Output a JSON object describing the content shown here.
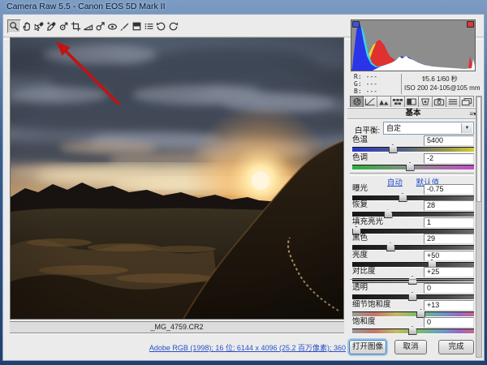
{
  "window": {
    "title": "Camera Raw 5.5 -  Canon EOS 5D Mark II"
  },
  "toolbar": {
    "tools": [
      {
        "name": "zoom-tool",
        "icon": "magnifier",
        "selected": true
      },
      {
        "name": "hand-tool",
        "icon": "hand",
        "selected": false
      },
      {
        "name": "white-balance-tool",
        "icon": "eyedropper-cursor",
        "selected": false
      },
      {
        "name": "color-sampler-tool",
        "icon": "eyedropper-plus",
        "selected": false
      },
      {
        "name": "targeted-adjustment-tool",
        "icon": "target",
        "selected": false
      },
      {
        "name": "crop-tool",
        "icon": "crop",
        "selected": false
      },
      {
        "name": "straighten-tool",
        "icon": "straighten",
        "selected": false
      },
      {
        "name": "spot-removal-tool",
        "icon": "heal",
        "selected": false
      },
      {
        "name": "red-eye-tool",
        "icon": "red-eye",
        "selected": false
      },
      {
        "name": "adjustment-brush-tool",
        "icon": "brush",
        "selected": false
      },
      {
        "name": "graduated-filter-tool",
        "icon": "grad-filter",
        "selected": false
      },
      {
        "name": "preferences-tool",
        "icon": "menu-list",
        "selected": false
      },
      {
        "name": "rotate-ccw-tool",
        "icon": "rotate-ccw",
        "selected": false
      },
      {
        "name": "rotate-cw-tool",
        "icon": "rotate-cw",
        "selected": false
      }
    ]
  },
  "annotation": {
    "type": "red-arrow",
    "points_to": "white-balance-tool",
    "color": "#c41212"
  },
  "histogram": {
    "shadow_clip_color": "#3a57d8",
    "highlight_clip_color": "#d83a3a"
  },
  "exif": {
    "r_label": "R:",
    "g_label": "G:",
    "b_label": "B:",
    "r_value": "---",
    "g_value": "---",
    "b_value": "---",
    "aperture_shutter": "f/5.6  1/60 秒",
    "iso_lens": "ISO 200  24-105@105 mm"
  },
  "tabs": [
    {
      "name": "tab-basic",
      "icon": "basic",
      "selected": true
    },
    {
      "name": "tab-tone-curve",
      "icon": "curve",
      "selected": false
    },
    {
      "name": "tab-detail",
      "icon": "detail",
      "selected": false
    },
    {
      "name": "tab-hsl-grayscale",
      "icon": "hsl",
      "selected": false
    },
    {
      "name": "tab-split-toning",
      "icon": "split",
      "selected": false
    },
    {
      "name": "tab-lens-corrections",
      "icon": "lens",
      "selected": false
    },
    {
      "name": "tab-camera-calibration",
      "icon": "camera",
      "selected": false
    },
    {
      "name": "tab-presets",
      "icon": "presets",
      "selected": false
    },
    {
      "name": "tab-snapshots",
      "icon": "snapshot",
      "selected": false
    }
  ],
  "panel": {
    "title": "基本",
    "white_balance_label": "白平衡:",
    "white_balance_value": "自定",
    "auto_link": "自动",
    "default_link": "默认值",
    "wb_sliders": [
      {
        "label": "色温",
        "value": "5400",
        "pos": 33,
        "track": "temp"
      },
      {
        "label": "色调",
        "value": "-2",
        "pos": 47,
        "track": "tint"
      }
    ],
    "tone_sliders": [
      {
        "label": "曝光",
        "value": "-0.75",
        "pos": 41,
        "track": "tone"
      },
      {
        "label": "恢复",
        "value": "28",
        "pos": 29,
        "track": "tone"
      },
      {
        "label": "填充亮光",
        "value": "1",
        "pos": 3,
        "track": "tone"
      },
      {
        "label": "黑色",
        "value": "29",
        "pos": 31,
        "track": "tone"
      },
      {
        "label": "亮度",
        "value": "+50",
        "pos": 65,
        "track": "tone"
      },
      {
        "label": "对比度",
        "value": "+25",
        "pos": 49,
        "track": "tone"
      }
    ],
    "presence_sliders": [
      {
        "label": "透明",
        "value": "0",
        "pos": 49,
        "track": "tone"
      },
      {
        "label": "细节饱和度",
        "value": "+13",
        "pos": 56,
        "track": "rainbow"
      },
      {
        "label": "饱和度",
        "value": "0",
        "pos": 49,
        "track": "rainbow"
      }
    ]
  },
  "footer": {
    "filename": "_MG_4759.CR2",
    "workflow_link": "Adobe RGB (1998); 16 位; 6144 x 4096 (25.2 百万像素); 360",
    "open_button": "打开图像",
    "cancel_button": "取消",
    "done_button": "完成"
  }
}
